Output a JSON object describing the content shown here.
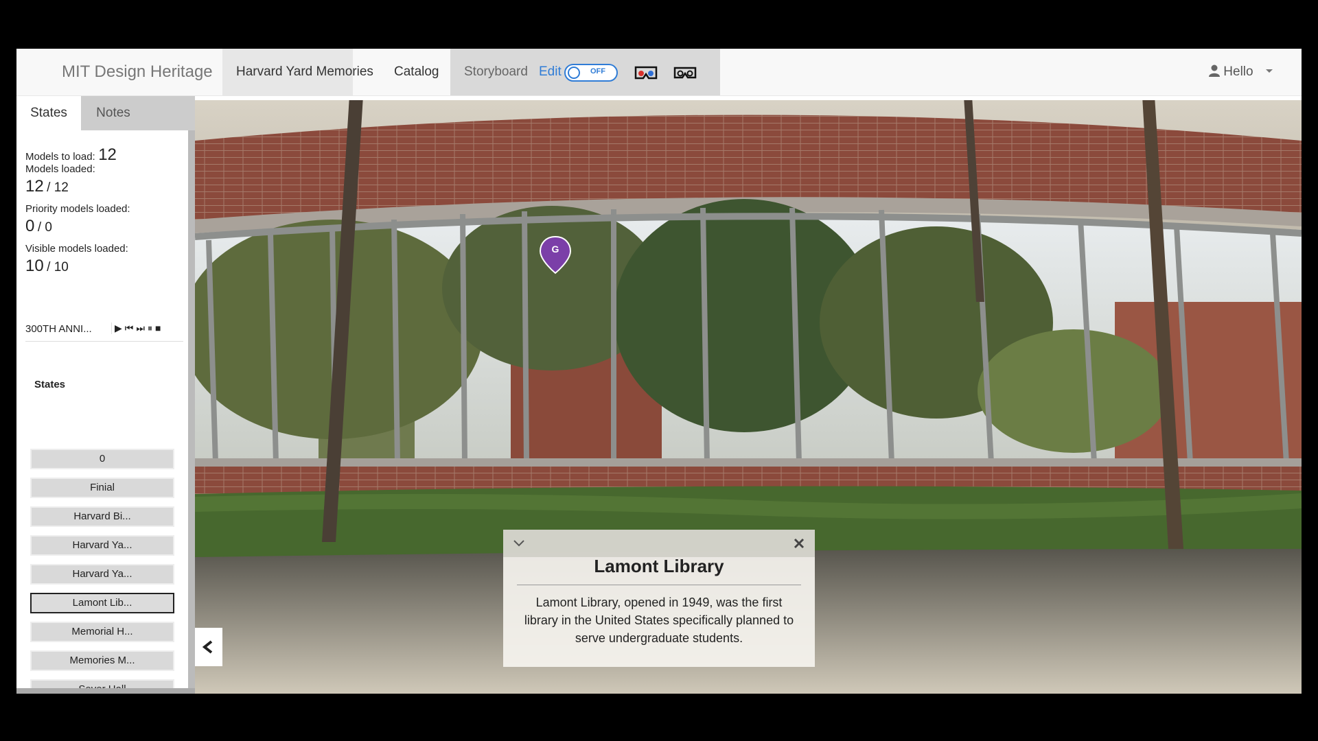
{
  "navbar": {
    "brand": "MIT Design Heritage",
    "items": [
      "Harvard Yard Memories",
      "Catalog",
      "Storyboard"
    ],
    "edit_label": "Edit",
    "toggle_state": "OFF",
    "user_label": "Hello",
    "icons": [
      "anaglyph-3d-icon",
      "vr-headset-icon",
      "user-icon",
      "caret-down-icon"
    ]
  },
  "sidebar": {
    "tabs": [
      "States",
      "Notes"
    ],
    "active_tab": "States",
    "stats": {
      "models_to_load_label": "Models to load:",
      "models_to_load": "12",
      "models_loaded_label": "Models loaded:",
      "models_loaded": "12",
      "models_loaded_total": "/ 12",
      "priority_label": "Priority models loaded:",
      "priority_loaded": "0",
      "priority_total": "/ 0",
      "visible_label": "Visible models loaded:",
      "visible_loaded": "10",
      "visible_total": "/ 10"
    },
    "player": {
      "title": "300TH ANNI...",
      "controls": [
        "play-icon",
        "skip-back-icon",
        "skip-forward-icon",
        "pause-icon",
        "stop-icon"
      ]
    },
    "states_heading": "States",
    "states": [
      "0",
      "Finial",
      "Harvard Bi...",
      "Harvard Ya...",
      "Harvard Ya...",
      "Lamont Lib...",
      "Memorial H...",
      "Memories M...",
      "Sever Hall"
    ],
    "selected_state": "Lamont Lib..."
  },
  "viewport": {
    "marker_letter": "G",
    "info": {
      "title": "Lamont Library",
      "body": "Lamont Library, opened in 1949, was the first library in the United States specifically planned to serve undergraduate students."
    }
  },
  "colors": {
    "accent": "#2f7cd6",
    "marker": "#7b3fa8",
    "brick": "#8b4a3c"
  }
}
